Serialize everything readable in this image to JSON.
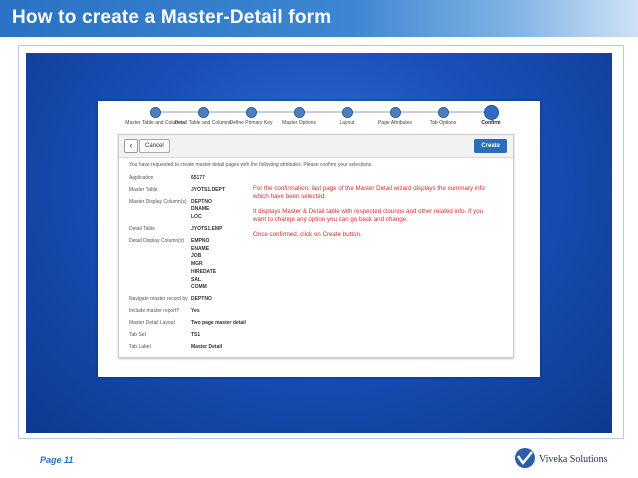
{
  "slide": {
    "title": "How to create a Master-Detail form",
    "page_label": "Page 11",
    "company_name": "Viveka Solutions"
  },
  "wizard": {
    "steps": [
      {
        "label": "Master Table and Columns"
      },
      {
        "label": "Detail Table and Columns"
      },
      {
        "label": "Define Primary Key"
      },
      {
        "label": "Master Options"
      },
      {
        "label": "Layout"
      },
      {
        "label": "Page Attributes"
      },
      {
        "label": "Tab Options"
      },
      {
        "label": "Confirm",
        "active": true
      }
    ],
    "toolbar": {
      "back_glyph": "‹",
      "cancel_label": "Cancel",
      "create_label": "Create"
    },
    "intro_text": "You have requested to create master detail pages with the following attributes. Please confirm your selections.",
    "summary": [
      {
        "label": "Application",
        "values": [
          "65177"
        ]
      },
      {
        "label": "Master Table",
        "values": [
          "JYOTS1.DEPT"
        ]
      },
      {
        "label": "Master Display Column(s)",
        "values": [
          "DEPTNO",
          "DNAME",
          "LOC"
        ]
      },
      {
        "label": "Detail Table",
        "values": [
          "JYOTS1.EMP"
        ]
      },
      {
        "label": "Detail Display Column(s)",
        "values": [
          "EMPNO",
          "ENAME",
          "JOB",
          "MGR",
          "HIREDATE",
          "SAL",
          "COMM"
        ]
      },
      {
        "label": "Navigate master record by",
        "values": [
          "DEPTNO"
        ]
      },
      {
        "label": "Include master report?",
        "values": [
          "Yes"
        ]
      },
      {
        "label": "Master Detail Layout",
        "values": [
          "Two page master detail"
        ]
      },
      {
        "label": "Tab Set",
        "values": [
          "TS1"
        ]
      },
      {
        "label": "Tab Label",
        "values": [
          "Master Detail"
        ]
      }
    ]
  },
  "annotation": {
    "paragraphs": [
      "For the confirmation, last page of the Master Detail wizard displays the summary info which have been selected.",
      "It displays Master & Detail table with respected clounns and other related info. If you want to change any option you can go back and change.",
      "Once confirmed, click on Create button."
    ]
  },
  "colors": {
    "title_bar": "#3d86d2",
    "panel_blue": "#1a4fb8",
    "annotation_red": "#d33030",
    "create_button": "#2e6cb7"
  }
}
